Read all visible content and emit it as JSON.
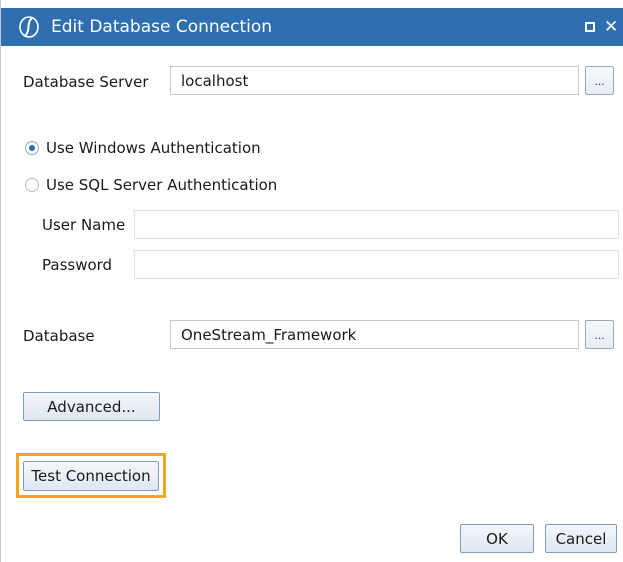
{
  "window": {
    "title": "Edit Database Connection",
    "accent_color": "#2f6fb0",
    "highlight_color": "#f2a71b",
    "icons": {
      "app": "onestream-logo-icon",
      "maximize": "maximize-icon",
      "close": "close-icon",
      "close_glyph": "✕"
    }
  },
  "server": {
    "label": "Database Server",
    "value": "localhost",
    "browse_label": "..."
  },
  "auth": {
    "selected": "windows",
    "windows_label": "Use Windows Authentication",
    "sql_label": "Use SQL Server Authentication",
    "username_label": "User Name",
    "username_value": "",
    "password_label": "Password",
    "password_value": ""
  },
  "database": {
    "label": "Database",
    "value": "OneStream_Framework",
    "browse_label": "..."
  },
  "buttons": {
    "advanced": "Advanced...",
    "test_connection": "Test Connection",
    "ok": "OK",
    "cancel": "Cancel"
  }
}
